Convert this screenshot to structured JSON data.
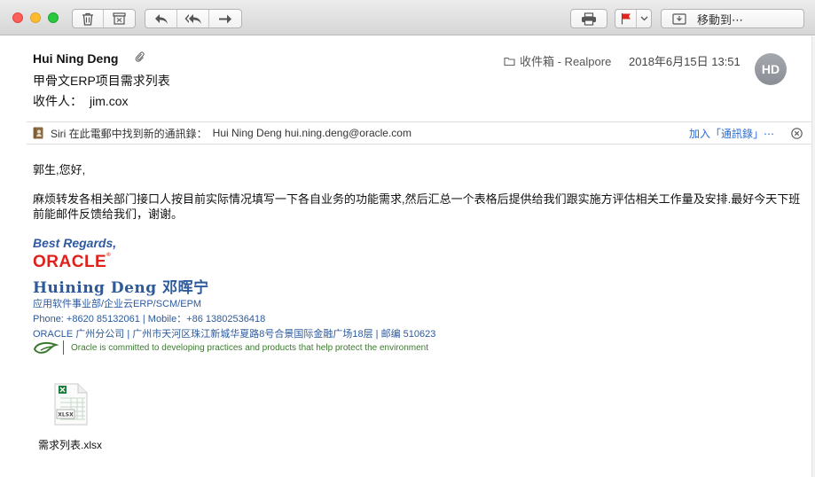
{
  "toolbar": {
    "delete_icon": "trash-icon",
    "junk_icon": "junk-box-icon",
    "reply_icon": "reply-icon",
    "reply_all_icon": "reply-all-icon",
    "forward_icon": "forward-icon",
    "print_icon": "printer-icon",
    "flag_icon": "flag-icon",
    "flag_color": "#e0251f",
    "move_label": "移動到⋯"
  },
  "header": {
    "from": "Hui Ning Deng",
    "subject": "甲骨文ERP项目需求列表",
    "to_label": "收件人：",
    "to_name": "jim.cox",
    "mailbox": "收件箱 - Realpore",
    "date": "2018年6月15日 13:51",
    "avatar_initials": "HD"
  },
  "siri": {
    "message": "Siri 在此電郵中找到新的通訊錄：",
    "contact": "Hui Ning Deng hui.ning.deng@oracle.com",
    "add_label": "加入「通訊錄」⋯"
  },
  "body": {
    "greeting": "郭生,您好,",
    "paragraph": "麻烦转发各相关部门接口人按目前实际情况填写一下各自业务的功能需求,然后汇总一个表格后提供给我们跟实施方评估相关工作量及安排.最好今天下班前能邮件反馈给我们，谢谢。"
  },
  "signature": {
    "best_regards": "Best Regards,",
    "logo_text": "ORACLE",
    "name": "Huining Deng 邓晖宁",
    "dept": "应用软件事业部/企业云ERP/SCM/EPM",
    "phone": "Phone: +8620 85132061 | Mobile：+86 13802536418",
    "address": "ORACLE 广州分公司 | 广州市天河区珠江新城华夏路8号合景国际金融广场18层 | 邮编 510623",
    "environment": "Oracle is committed to developing practices and products that help protect the environment",
    "brand_red": "#e0201b",
    "brand_blue": "#2c5a9c",
    "env_green": "#3b7a2f"
  },
  "attachment": {
    "filename": "需求列表.xlsx",
    "icon_label": "XLSX"
  }
}
